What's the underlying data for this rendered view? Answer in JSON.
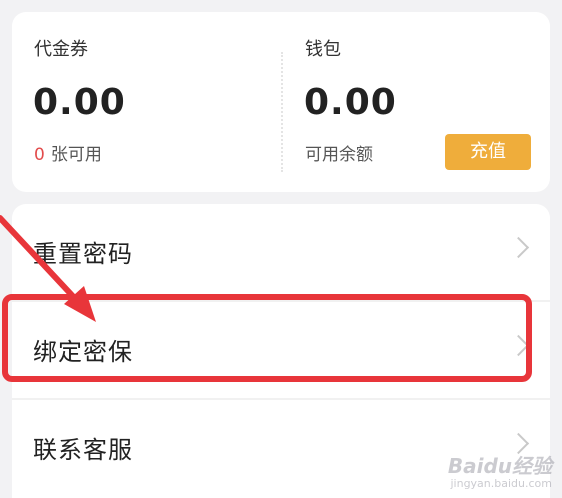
{
  "wallet_card": {
    "voucher": {
      "label": "代金券",
      "amount": "0.00",
      "count": "0",
      "count_suffix": "张可用"
    },
    "wallet": {
      "label": "钱包",
      "amount": "0.00",
      "balance_label": "可用余额",
      "recharge_label": "充值"
    }
  },
  "menu": {
    "items": [
      {
        "label": "重置密码"
      },
      {
        "label": "绑定密保"
      },
      {
        "label": "联系客服"
      }
    ]
  },
  "annotation": {
    "highlight_color": "#e8353a"
  },
  "watermark": {
    "text": "Baidu经验",
    "sub": "jingyan.baidu.com"
  },
  "colors": {
    "accent_button": "#efad3b",
    "count_red": "#e24c4c"
  }
}
